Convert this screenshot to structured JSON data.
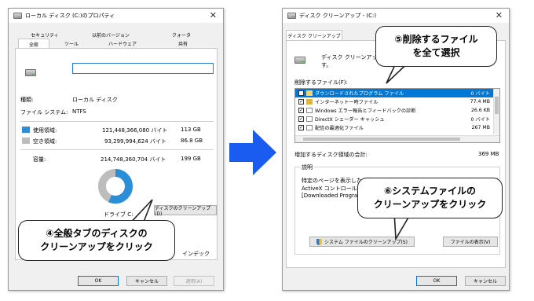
{
  "left_dialog": {
    "title": "ローカル ディスク (C:)のプロパティ",
    "tabs_row1": [
      "セキュリティ",
      "以前のバージョン",
      "クォータ"
    ],
    "tabs_row2": [
      "全般",
      "ツール",
      "ハードウェア",
      "共有"
    ],
    "type_label": "種類:",
    "type_value": "ローカル ディスク",
    "fs_label": "ファイル システム:",
    "fs_value": "NTFS",
    "used_label": "使用領域:",
    "used_bytes": "121,448,366,080 バイト",
    "used_gb": "113 GB",
    "free_label": "空き領域:",
    "free_bytes": "93,299,994,624 バイト",
    "free_gb": "86.8 GB",
    "capacity_label": "容量:",
    "capacity_bytes": "214,748,360,704 バイト",
    "capacity_gb": "199 GB",
    "used_fraction": 0.566,
    "drive_label": "ドライブ C:",
    "cleanup_button": "ディスクのクリーンアップ(D)",
    "hidden_text": "インデック",
    "ok": "OK",
    "cancel": "キャンセル",
    "apply": "適用(A)",
    "used_color": "#2a8fd6",
    "free_color": "#bdbdbd"
  },
  "arrow_color": "#1a5cf0",
  "right_dialog": {
    "title": "ディスク クリーンアップ - (C:)",
    "tab": "ディスク クリーンアップ",
    "intro": "ディスク クリーンアップ",
    "intro2": "す。",
    "files_label": "削除するファイル(F):",
    "files": [
      {
        "name": "ダウンロードされたプログラム ファイル",
        "size": "0 バイト",
        "checked": true,
        "selected": true
      },
      {
        "name": "インターネット一時ファイル",
        "size": "77.4 MB",
        "checked": true,
        "selected": false
      },
      {
        "name": "Windows エラー報告とフィードバックの診断",
        "size": "26.6 KB",
        "checked": true,
        "selected": false
      },
      {
        "name": "DirectX シェーダー キャッシュ",
        "size": "0 バイト",
        "checked": true,
        "selected": false
      },
      {
        "name": "配信の最適化ファイル",
        "size": "267 MB",
        "checked": true,
        "selected": false
      }
    ],
    "total_label": "増加するディスク領域の合計:",
    "total_value": "369 MB",
    "desc_label": "説明",
    "desc_line1": "特定のページを表示したときにインターネットから自動的にダウンロードされる",
    "desc_line2": "ActiveX コントロール",
    "desc_line3": "[Downloaded Progra",
    "system_button": "システム ファイルのクリーンアップ(S)",
    "view_button": "ファイルの表示(V)",
    "ok": "OK",
    "cancel": "キャンセル"
  },
  "callouts": {
    "step4_line1": "④全般タブのディスクの",
    "step4_line2": "クリーンアップをクリック",
    "step5_line1": "⑤削除するファイル",
    "step5_line2": "を全て選択",
    "step6_line1": "⑥システムファイルの",
    "step6_line2": "クリーンアップをクリック"
  }
}
